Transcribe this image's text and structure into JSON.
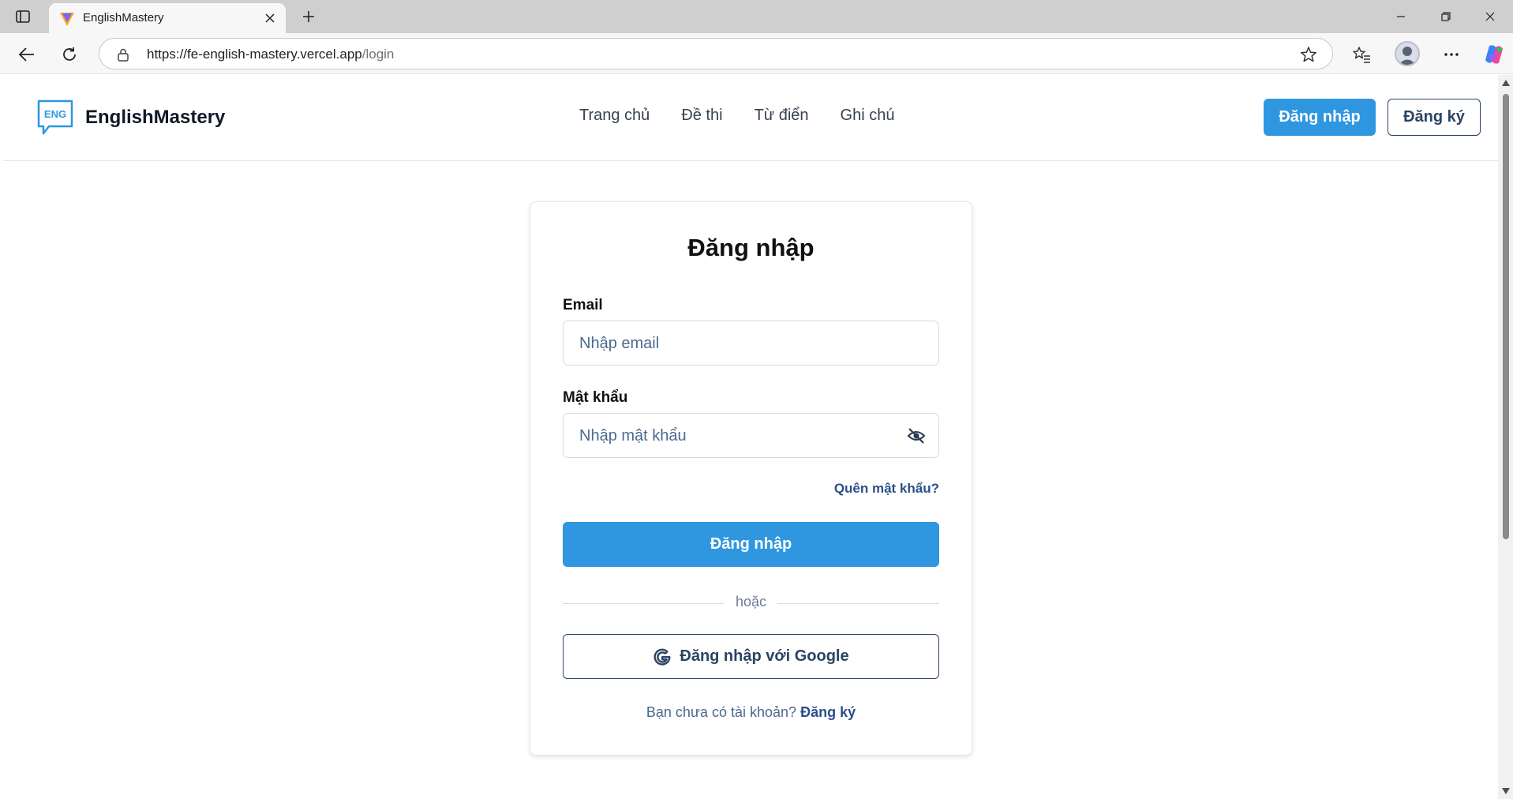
{
  "browser": {
    "tab_title": "EnglishMastery",
    "url_host": "https://fe-english-mastery.vercel.app",
    "url_path": "/login"
  },
  "site": {
    "logo_badge": "ENG",
    "logo_text": "EnglishMastery",
    "nav": [
      "Trang chủ",
      "Đề thi",
      "Từ điển",
      "Ghi chú"
    ],
    "login_button": "Đăng nhập",
    "register_button": "Đăng ký"
  },
  "login_form": {
    "title": "Đăng nhập",
    "email_label": "Email",
    "email_placeholder": "Nhập email",
    "password_label": "Mật khẩu",
    "password_placeholder": "Nhập mật khẩu",
    "forgot_password": "Quên mật khẩu?",
    "submit_label": "Đăng nhập",
    "divider_text": "hoặc",
    "google_label": "Đăng nhập với Google",
    "no_account_text": "Bạn chưa có tài khoản?",
    "signup_link": "Đăng ký"
  },
  "colors": {
    "primary": "#2f96e0",
    "dark_blue": "#2b4463",
    "link_blue": "#2b4f86"
  },
  "icons": [
    "sidebar-toggle-icon",
    "favicon-icon",
    "close-icon",
    "plus-icon",
    "minimize-icon",
    "restore-icon",
    "window-close-icon",
    "back-arrow-icon",
    "refresh-icon",
    "lock-icon",
    "star-icon",
    "favorites-icon",
    "more-icon",
    "copilot-icon",
    "eye-off-icon",
    "google-icon"
  ]
}
